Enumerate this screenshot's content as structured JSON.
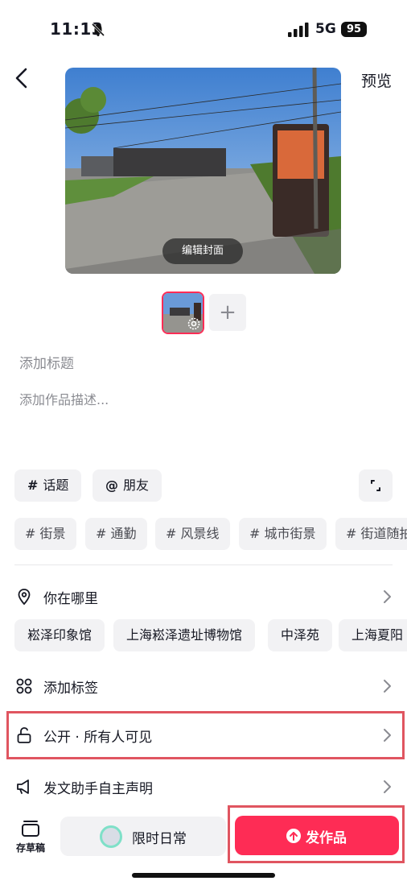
{
  "status_bar": {
    "time": "11:13",
    "network": "5G",
    "battery": "95"
  },
  "header": {
    "preview_label": "预览"
  },
  "cover": {
    "edit_label": "编辑封面"
  },
  "thumbnails": {
    "add_symbol": "+"
  },
  "inputs": {
    "title_placeholder": "添加标题",
    "description_placeholder": "添加作品描述..."
  },
  "quick_chips": [
    {
      "symbol": "#",
      "label": "话题"
    },
    {
      "symbol": "@",
      "label": "朋友"
    }
  ],
  "hashtags": [
    "# 街景",
    "# 通勤",
    "# 风景线",
    "# 城市街景",
    "# 街道随拍"
  ],
  "location": {
    "label": "你在哪里",
    "suggestions": [
      "崧泽印象馆",
      "上海崧泽遗址博物馆",
      "中泽苑",
      "上海夏阳"
    ]
  },
  "rows": {
    "add_tag": "添加标签",
    "visibility": "公开 · 所有人可见",
    "declaration": "发文助手自主声明"
  },
  "bottom_bar": {
    "drafts_label": "存草稿",
    "daily_label": "限时日常",
    "publish_label": "发作品"
  },
  "colors": {
    "accent": "#fe2c55",
    "highlight": "#e05560",
    "chip_bg": "#f2f2f4"
  },
  "icons": [
    "chevron-left-icon",
    "bell-slash-icon",
    "signal-icon",
    "settings-icon",
    "plus-icon",
    "expand-icon",
    "location-pin-icon",
    "chevron-right-icon",
    "grid-icon",
    "lock-open-icon",
    "megaphone-icon",
    "drafts-icon",
    "upload-icon"
  ]
}
